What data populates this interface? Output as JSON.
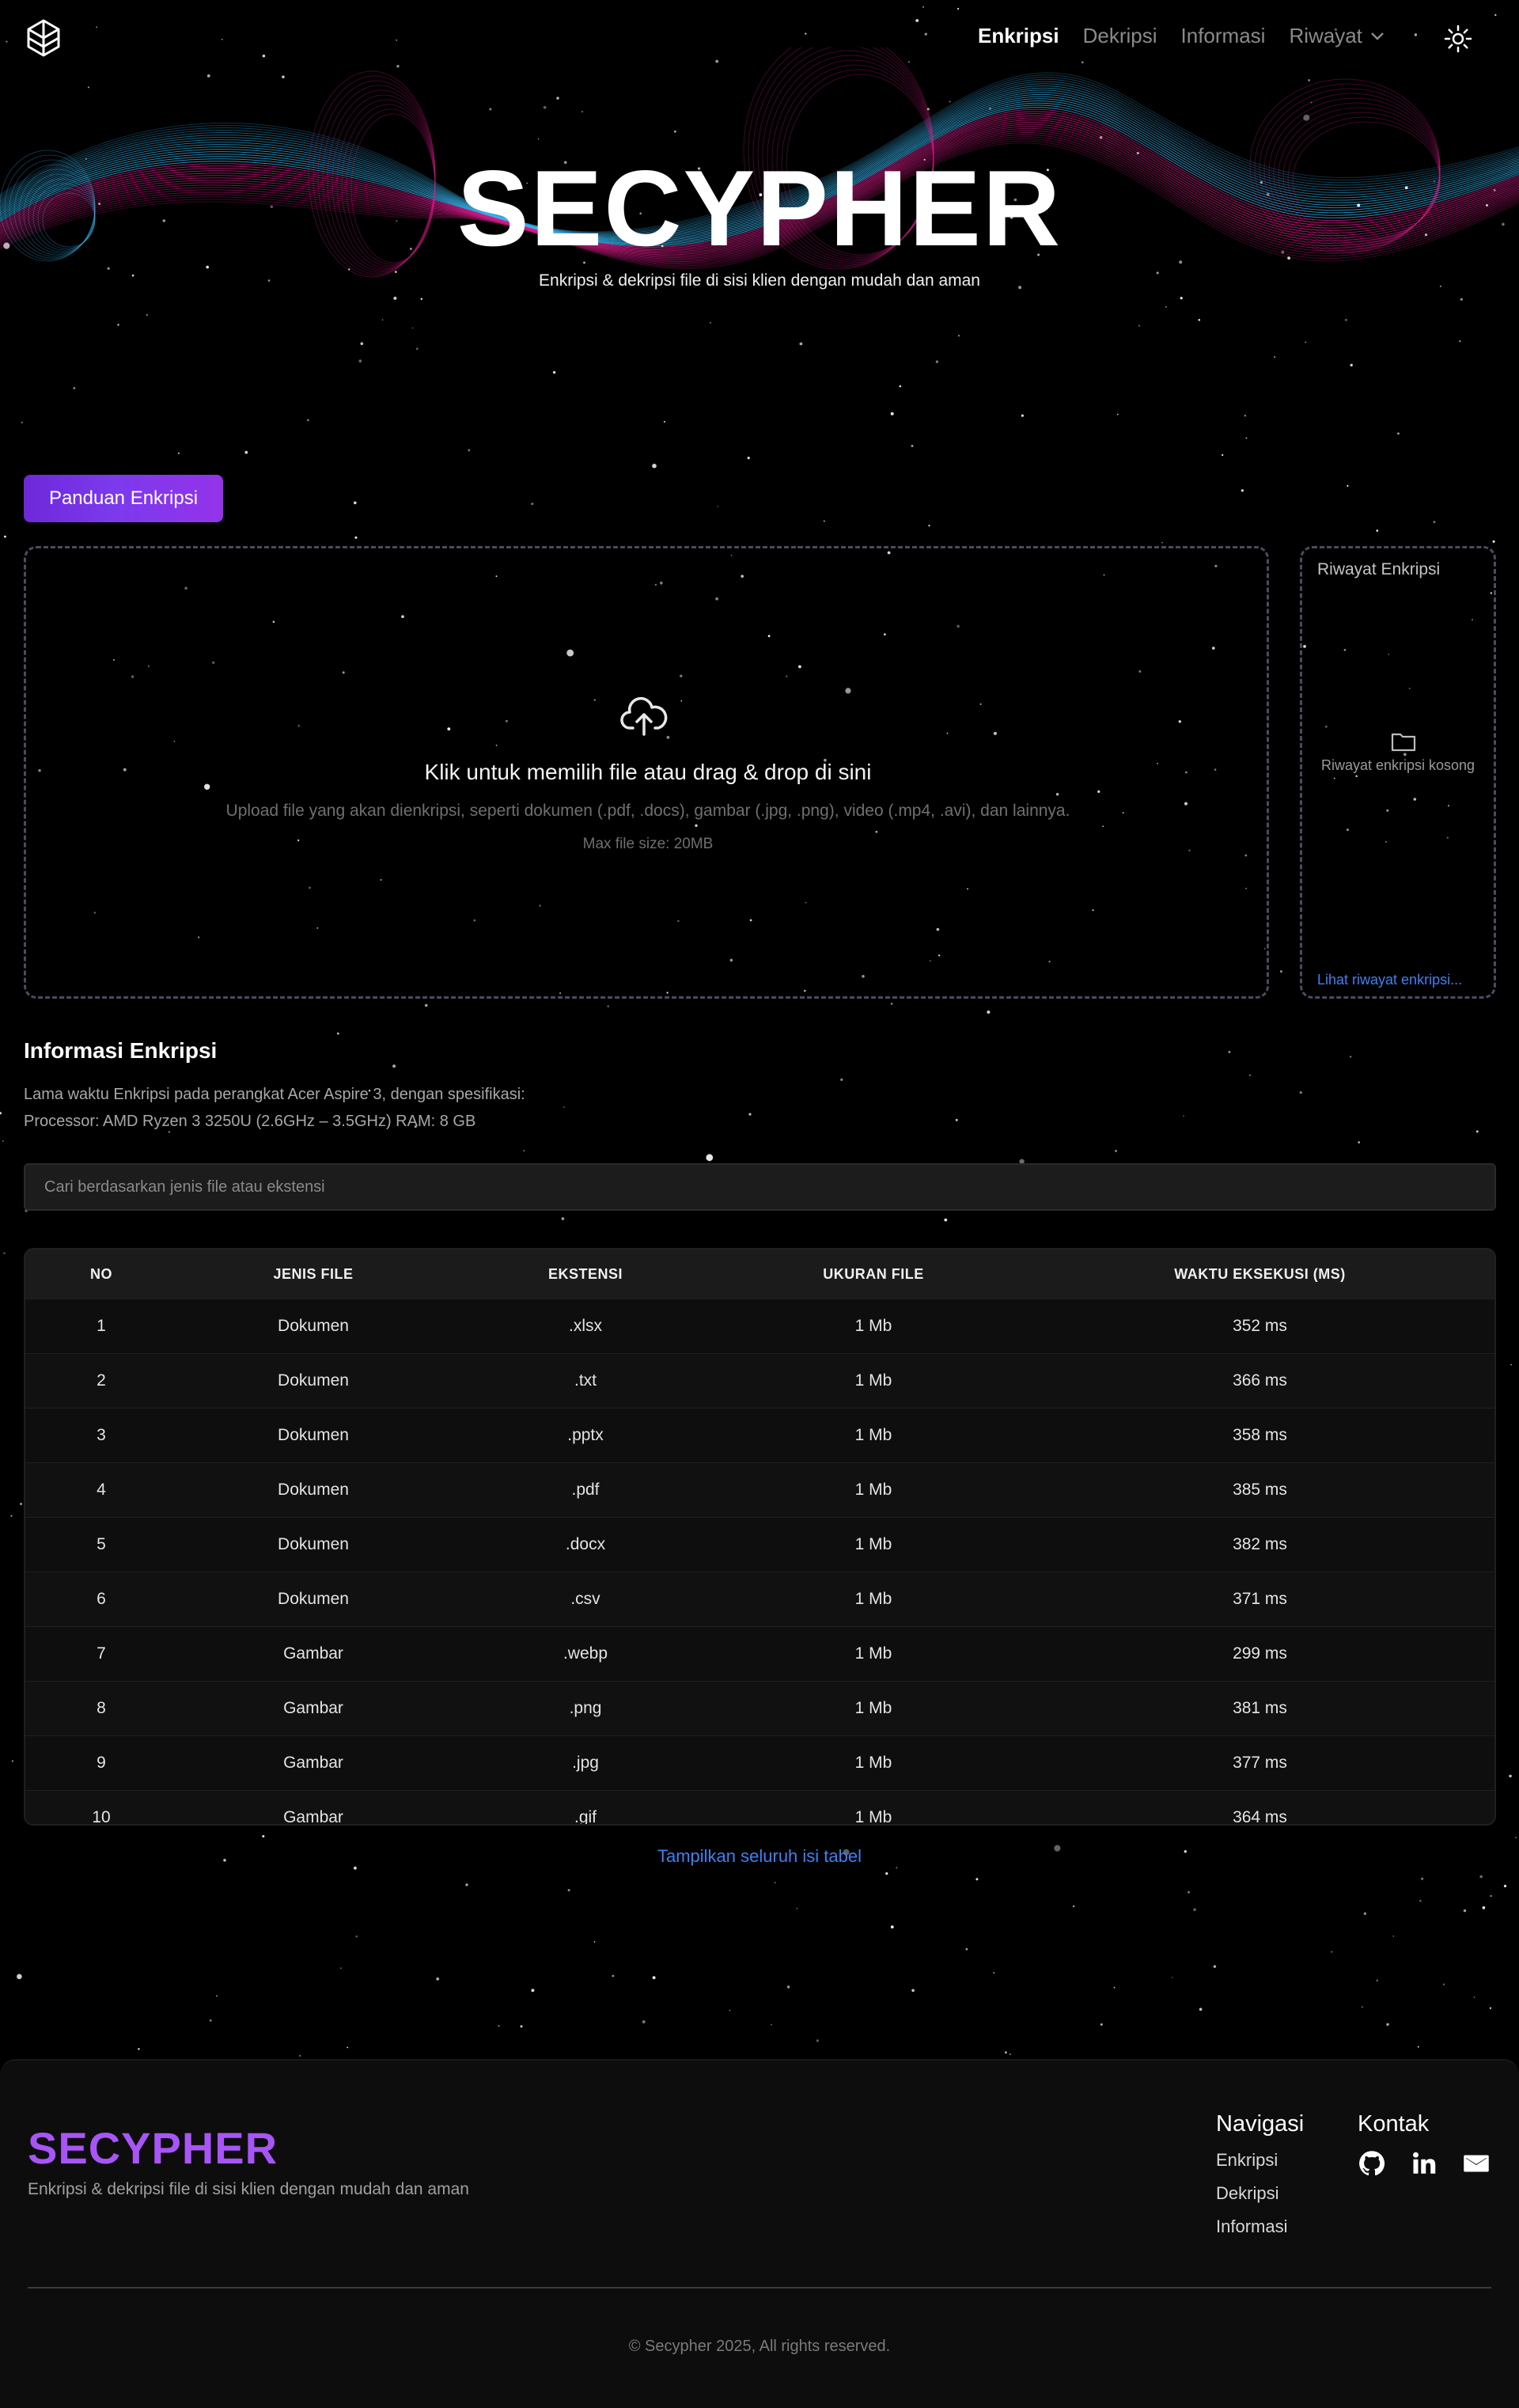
{
  "nav": {
    "items": [
      {
        "label": "Enkripsi",
        "active": true
      },
      {
        "label": "Dekripsi",
        "active": false
      },
      {
        "label": "Informasi",
        "active": false
      },
      {
        "label": "Riwayat",
        "active": false,
        "dropdown": true
      }
    ],
    "logo_icon": "cube-stack-logo-icon",
    "theme_icon": "sun-icon"
  },
  "hero": {
    "title": "SECYPHER",
    "subtitle": "Enkripsi & dekripsi file di sisi klien dengan mudah dan aman"
  },
  "guide_button": "Panduan Enkripsi",
  "upload": {
    "icon": "cloud-upload-icon",
    "title": "Klik untuk memilih file atau drag & drop di sini",
    "description": "Upload file yang akan dienkripsi, seperti dokumen (.pdf, .docs), gambar (.jpg, .png), video (.mp4, .avi), dan lainnya.",
    "max_size": "Max file size: 20MB"
  },
  "history": {
    "title": "Riwayat Enkripsi",
    "icon": "folder-icon",
    "empty": "Riwayat enkripsi kosong",
    "link": "Lihat riwayat enkripsi..."
  },
  "info": {
    "title": "Informasi Enkripsi",
    "line1": "Lama waktu Enkripsi pada perangkat Acer Aspire 3, dengan spesifikasi:",
    "line2": "Processor: AMD Ryzen 3 3250U (2.6GHz – 3.5GHz) RAM: 8 GB"
  },
  "search": {
    "placeholder": "Cari berdasarkan jenis file atau ekstensi"
  },
  "table": {
    "headers": [
      "No",
      "Jenis File",
      "Ekstensi",
      "Ukuran File",
      "Waktu Eksekusi (ms)"
    ],
    "rows": [
      [
        "1",
        "Dokumen",
        ".xlsx",
        "1 Mb",
        "352 ms"
      ],
      [
        "2",
        "Dokumen",
        ".txt",
        "1 Mb",
        "366 ms"
      ],
      [
        "3",
        "Dokumen",
        ".pptx",
        "1 Mb",
        "358 ms"
      ],
      [
        "4",
        "Dokumen",
        ".pdf",
        "1 Mb",
        "385 ms"
      ],
      [
        "5",
        "Dokumen",
        ".docx",
        "1 Mb",
        "382 ms"
      ],
      [
        "6",
        "Dokumen",
        ".csv",
        "1 Mb",
        "371 ms"
      ],
      [
        "7",
        "Gambar",
        ".webp",
        "1 Mb",
        "299 ms"
      ],
      [
        "8",
        "Gambar",
        ".png",
        "1 Mb",
        "381 ms"
      ],
      [
        "9",
        "Gambar",
        ".jpg",
        "1 Mb",
        "377 ms"
      ],
      [
        "10",
        "Gambar",
        ".gif",
        "1 Mb",
        "364 ms"
      ]
    ]
  },
  "show_all": "Tampilkan seluruh isi tabel",
  "footer": {
    "brand": "SECYPHER",
    "description": "Enkripsi & dekripsi file di sisi klien dengan mudah dan aman",
    "nav_title": "Navigasi",
    "nav_links": [
      "Enkripsi",
      "Dekripsi",
      "Informasi"
    ],
    "contact_title": "Kontak",
    "contact_icons": [
      "github-icon",
      "linkedin-icon",
      "mail-icon"
    ],
    "copyright": "© Secypher 2025, All rights reserved."
  },
  "colors": {
    "background": "#000000",
    "accent_purple": "#a855f7",
    "button_gradient_start": "#6d28d9",
    "button_gradient_end": "#9333ea",
    "link_blue": "#3b82f6",
    "wave_cyan": "#38bdf8",
    "wave_magenta": "#e11d8f"
  }
}
